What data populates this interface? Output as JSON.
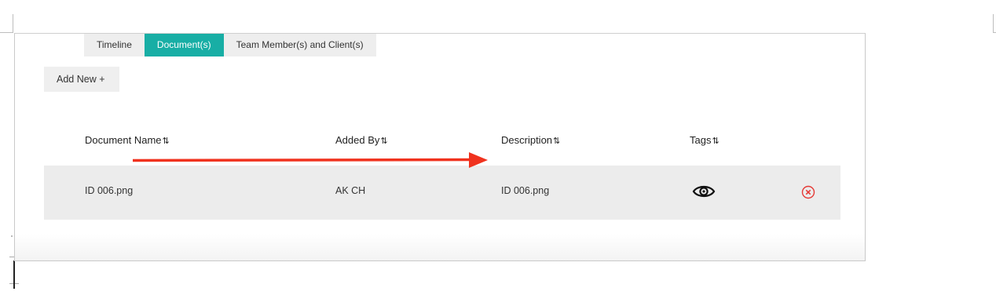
{
  "tabs": [
    {
      "label": "Timeline",
      "active": false
    },
    {
      "label": "Document(s)",
      "active": true
    },
    {
      "label": "Team Member(s) and Client(s)",
      "active": false
    }
  ],
  "add_button": {
    "label": "Add New +"
  },
  "table": {
    "headers": [
      {
        "label": "Document Name",
        "sort_icon": "⇅"
      },
      {
        "label": "Added By",
        "sort_icon": "⇅"
      },
      {
        "label": "Description",
        "sort_icon": "⇅"
      },
      {
        "label": "Tags",
        "sort_icon": "⇅"
      }
    ],
    "rows": [
      {
        "document_name": "ID 006.png",
        "added_by": "AK CH",
        "description": "ID 006.png",
        "tags_icon": "eye-icon",
        "delete_icon": "close-circle-icon"
      }
    ]
  },
  "colors": {
    "accent": "#18aea5",
    "annotation_arrow": "#f0321e",
    "delete": "#e53935"
  }
}
